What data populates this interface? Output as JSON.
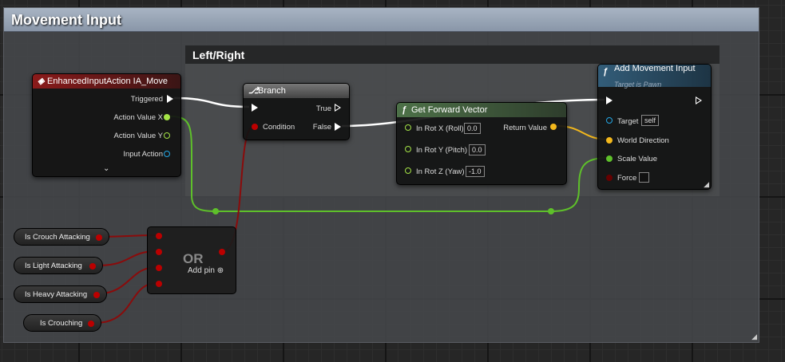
{
  "comment_outer": {
    "title": "Movement Input"
  },
  "comment_inner": {
    "title": "Left/Right"
  },
  "colors": {
    "exec": "#ffffff",
    "float": "#a4e346",
    "bool": "#b00000",
    "vector": "#f3b81c",
    "object": "#24a7e5"
  },
  "node_input": {
    "icon": "event-icon",
    "title": "EnhancedInputAction IA_Move",
    "pins": {
      "triggered": "Triggered",
      "action_x": "Action Value X",
      "action_y": "Action Value Y",
      "input_action": "Input Action"
    }
  },
  "node_branch": {
    "icon": "branch-icon",
    "title": "Branch",
    "pins": {
      "condition": "Condition",
      "true": "True",
      "false": "False"
    }
  },
  "node_forward": {
    "icon": "f",
    "title": "Get Forward Vector",
    "pins": {
      "roll": "In Rot X (Roll)",
      "pitch": "In Rot Y (Pitch)",
      "yaw": "In Rot Z (Yaw)",
      "return": "Return Value"
    },
    "values": {
      "roll": "0.0",
      "pitch": "0.0",
      "yaw": "-1.0"
    }
  },
  "node_move": {
    "icon": "f",
    "title": "Add Movement Input",
    "subtitle": "Target is Pawn",
    "pins": {
      "target": "Target",
      "direction": "World Direction",
      "scale": "Scale Value",
      "force": "Force"
    },
    "values": {
      "target": "self"
    }
  },
  "node_or": {
    "title": "OR",
    "add_pin": "Add pin"
  },
  "variables": [
    "Is Crouch Attacking",
    "Is Light Attacking",
    "Is Heavy Attacking",
    "Is Crouching"
  ]
}
